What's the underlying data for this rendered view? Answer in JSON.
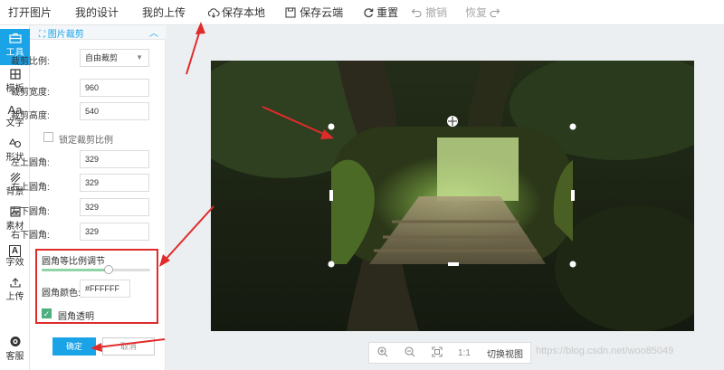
{
  "toolbar": {
    "open_image": "打开图片",
    "my_designs": "我的设计",
    "my_uploads": "我的上传",
    "save_local": "保存本地",
    "save_cloud": "保存云端",
    "reset": "重置",
    "undo": "撤销",
    "redo": "恢复"
  },
  "nav": {
    "tools": "工具",
    "templates": "模板",
    "text": "文字",
    "shapes": "形状",
    "background": "背景",
    "materials": "素材",
    "font_effects": "字效",
    "upload": "上传",
    "support": "客服"
  },
  "nav_icons": {
    "tools": "toolbox-icon",
    "templates": "grid-icon",
    "text_glyph": "Aa",
    "font_effects_glyph": "A"
  },
  "panel": {
    "title": "图片裁剪",
    "crop_ratio_label": "裁剪比例:",
    "crop_ratio_value": "自由裁剪",
    "width_label": "裁剪宽度:",
    "width_value": "960",
    "height_label": "裁剪高度:",
    "height_value": "540",
    "lock_ratio_label": "锁定裁剪比例",
    "lock_ratio_checked": false,
    "corner_tl_label": "左上圆角:",
    "corner_tl_value": "329",
    "corner_tr_label": "右上圆角:",
    "corner_tr_value": "329",
    "corner_bl_label": "左下圆角:",
    "corner_bl_value": "329",
    "corner_br_label": "右下圆角:",
    "corner_br_value": "329",
    "proportional_label": "圆角等比例调节",
    "proportional_fraction": 0.62,
    "corner_color_label": "圆角颜色:",
    "corner_color_value": "#FFFFFF",
    "transparent_label": "圆角透明",
    "transparent_checked": true,
    "ok_label": "确定",
    "cancel_label": "取消"
  },
  "bottom": {
    "zoom_in": "zoom-in-icon",
    "zoom_out": "zoom-out-icon",
    "fit": "fit-icon",
    "ratio": "1:1",
    "switch_view": "切换视图"
  },
  "watermark": "https://blog.csdn.net/woo85049",
  "colors": {
    "accent": "#1ba3e8",
    "annotation_red": "#e02b2b",
    "slider_fill": "#8fd5a6",
    "check_green": "#4caf7d"
  }
}
